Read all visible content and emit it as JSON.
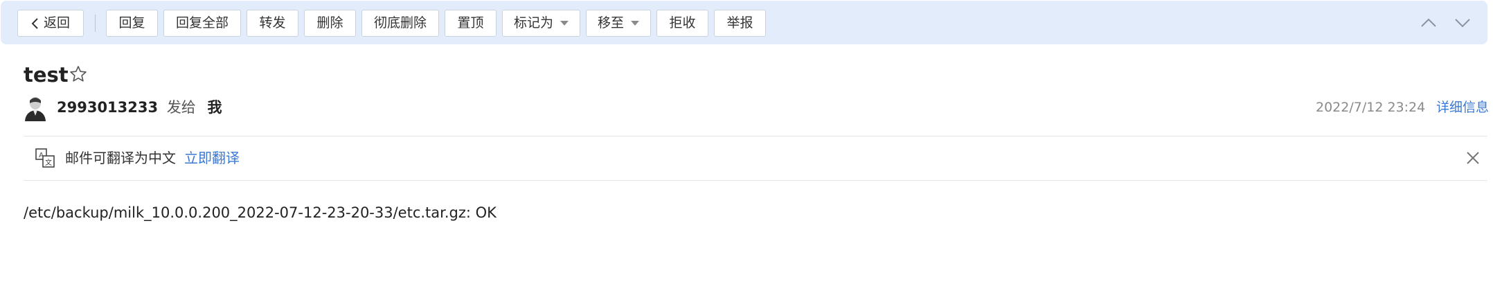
{
  "toolbar": {
    "back_label": "返回",
    "buttons": [
      "回复",
      "回复全部",
      "转发",
      "删除",
      "彻底删除",
      "置顶",
      "标记为",
      "移至",
      "拒收",
      "举报"
    ]
  },
  "email": {
    "subject": "test",
    "sender": "2993013233",
    "sent_to_text": "发给",
    "recipient": "我",
    "date": "2022/7/12 23:24",
    "detail_link": "详细信息",
    "body": "/etc/backup/milk_10.0.0.200_2022-07-12-23-20-33/etc.tar.gz: OK"
  },
  "translate_bar": {
    "message": "邮件可翻译为中文",
    "action": "立即翻译"
  },
  "icons": {
    "back": "chevron-left-icon",
    "star": "star-outline-icon",
    "avatar": "user-avatar",
    "translate": "translate-icon",
    "close": "close-icon",
    "prev": "chevron-up-icon",
    "next": "chevron-down-icon"
  },
  "colors": {
    "toolbar_bg": "#e2ecfb",
    "link": "#3a78d6",
    "muted": "#8a8a8a",
    "text": "#333333"
  }
}
